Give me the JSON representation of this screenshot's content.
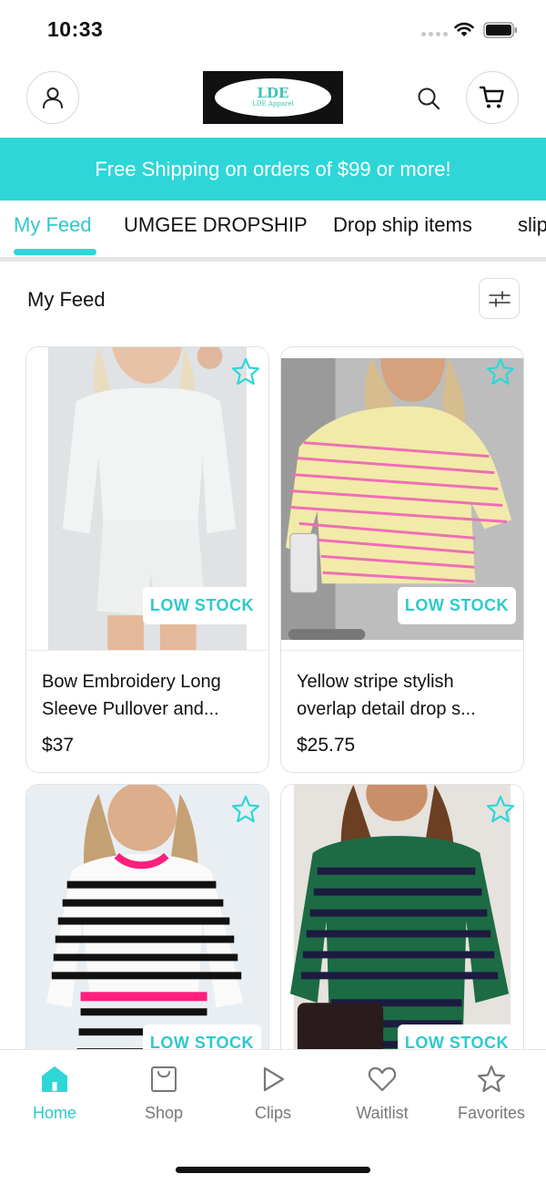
{
  "status": {
    "time": "10:33"
  },
  "header": {
    "logo_mark": "LDE",
    "logo_text": "LDE Apparel"
  },
  "banner": {
    "text": "Free Shipping on orders of $99 or more!"
  },
  "tabs": [
    {
      "label": "My Feed",
      "active": true
    },
    {
      "label": "UMGEE DROPSHIP",
      "active": false
    },
    {
      "label": "Drop ship items",
      "active": false
    },
    {
      "label": "slip",
      "active": false
    }
  ],
  "feed": {
    "title": "My Feed"
  },
  "products": [
    {
      "name": "Bow Embroidery Long Sleeve Pullover and...",
      "price": "$37",
      "badge": "LOW STOCK"
    },
    {
      "name": "Yellow stripe stylish overlap detail drop s...",
      "price": "$25.75",
      "badge": "LOW STOCK"
    },
    {
      "name": "",
      "price": "",
      "badge": "LOW STOCK"
    },
    {
      "name": "",
      "price": "",
      "badge": "LOW STOCK"
    }
  ],
  "bottom_nav": [
    {
      "label": "Home",
      "icon": "home-icon",
      "active": true
    },
    {
      "label": "Shop",
      "icon": "shop-icon",
      "active": false
    },
    {
      "label": "Clips",
      "icon": "play-icon",
      "active": false
    },
    {
      "label": "Waitlist",
      "icon": "heart-icon",
      "active": false
    },
    {
      "label": "Favorites",
      "icon": "star-icon",
      "active": false
    }
  ],
  "colors": {
    "accent": "#2ed6d8",
    "accent_text": "#2ec9cf",
    "nav_inactive": "#777777"
  }
}
